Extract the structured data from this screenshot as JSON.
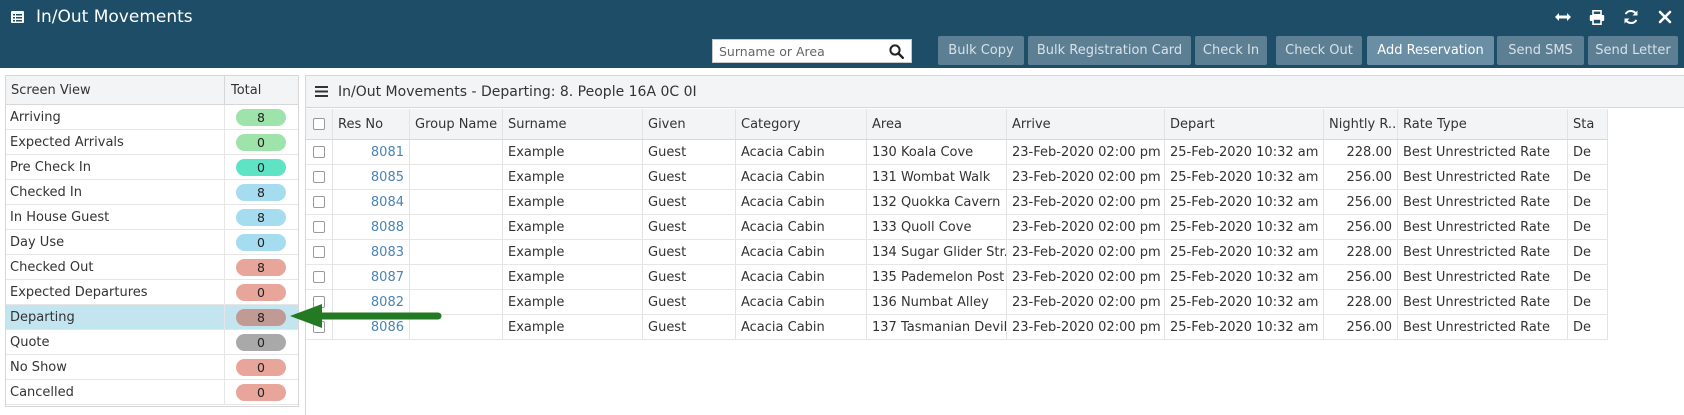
{
  "window": {
    "title": "In/Out Movements",
    "icons": [
      "resize-icon",
      "print-icon",
      "refresh-icon",
      "close-icon"
    ]
  },
  "toolbar": {
    "search_placeholder": "Surname or Area",
    "buttons": {
      "bulk_copy": "Bulk Copy",
      "bulk_registration_card": "Bulk Registration Card",
      "check_in": "Check In",
      "check_out": "Check Out",
      "add_reservation": "Add Reservation",
      "send_sms": "Send SMS",
      "send_letter": "Send Letter"
    }
  },
  "screen_view": {
    "header_view": "Screen View",
    "header_total": "Total",
    "selected": "Departing",
    "items": [
      {
        "label": "Arriving",
        "total": "8",
        "color": "#9ee3a9"
      },
      {
        "label": "Expected Arrivals",
        "total": "0",
        "color": "#9ee3a9"
      },
      {
        "label": "Pre Check In",
        "total": "0",
        "color": "#5ee3c4"
      },
      {
        "label": "Checked In",
        "total": "8",
        "color": "#a6dcef"
      },
      {
        "label": "In House Guest",
        "total": "8",
        "color": "#a6dcef"
      },
      {
        "label": "Day Use",
        "total": "0",
        "color": "#a6dcef"
      },
      {
        "label": "Checked Out",
        "total": "8",
        "color": "#e8a599"
      },
      {
        "label": "Expected Departures",
        "total": "0",
        "color": "#e8a599"
      },
      {
        "label": "Departing",
        "total": "8",
        "color": "#c09a93"
      },
      {
        "label": "Quote",
        "total": "0",
        "color": "#a9a9a9"
      },
      {
        "label": "No Show",
        "total": "0",
        "color": "#e8a599"
      },
      {
        "label": "Cancelled",
        "total": "0",
        "color": "#e8a599"
      }
    ]
  },
  "grid": {
    "title": "In/Out Movements - Departing: 8. People 16A 0C 0I",
    "columns": [
      "Res No",
      "Group Name",
      "Surname",
      "Given",
      "Category",
      "Area",
      "Arrive",
      "Depart",
      "Nightly R...",
      "Rate Type",
      "Sta"
    ],
    "rows": [
      {
        "res_no": "8081",
        "group": "",
        "surname": "Example",
        "given": "Guest",
        "category": "Acacia Cabin",
        "area": "130 Koala Cove",
        "arrive": "23-Feb-2020 02:00 pm",
        "depart": "25-Feb-2020 10:32 am",
        "rate": "228.00",
        "rate_type": "Best Unrestricted Rate",
        "status": "De"
      },
      {
        "res_no": "8085",
        "group": "",
        "surname": "Example",
        "given": "Guest",
        "category": "Acacia Cabin",
        "area": "131 Wombat Walk",
        "arrive": "23-Feb-2020 02:00 pm",
        "depart": "25-Feb-2020 10:32 am",
        "rate": "256.00",
        "rate_type": "Best Unrestricted Rate",
        "status": "De"
      },
      {
        "res_no": "8084",
        "group": "",
        "surname": "Example",
        "given": "Guest",
        "category": "Acacia Cabin",
        "area": "132 Quokka Cavern",
        "arrive": "23-Feb-2020 02:00 pm",
        "depart": "25-Feb-2020 10:32 am",
        "rate": "256.00",
        "rate_type": "Best Unrestricted Rate",
        "status": "De"
      },
      {
        "res_no": "8088",
        "group": "",
        "surname": "Example",
        "given": "Guest",
        "category": "Acacia Cabin",
        "area": "133 Quoll Cove",
        "arrive": "23-Feb-2020 02:00 pm",
        "depart": "25-Feb-2020 10:32 am",
        "rate": "256.00",
        "rate_type": "Best Unrestricted Rate",
        "status": "De"
      },
      {
        "res_no": "8083",
        "group": "",
        "surname": "Example",
        "given": "Guest",
        "category": "Acacia Cabin",
        "area": "134 Sugar Glider Str...",
        "arrive": "23-Feb-2020 02:00 pm",
        "depart": "25-Feb-2020 10:32 am",
        "rate": "228.00",
        "rate_type": "Best Unrestricted Rate",
        "status": "De"
      },
      {
        "res_no": "8087",
        "group": "",
        "surname": "Example",
        "given": "Guest",
        "category": "Acacia Cabin",
        "area": "135 Pademelon Post",
        "arrive": "23-Feb-2020 02:00 pm",
        "depart": "25-Feb-2020 10:32 am",
        "rate": "256.00",
        "rate_type": "Best Unrestricted Rate",
        "status": "De"
      },
      {
        "res_no": "8082",
        "group": "",
        "surname": "Example",
        "given": "Guest",
        "category": "Acacia Cabin",
        "area": "136 Numbat Alley",
        "arrive": "23-Feb-2020 02:00 pm",
        "depart": "25-Feb-2020 10:32 am",
        "rate": "228.00",
        "rate_type": "Best Unrestricted Rate",
        "status": "De"
      },
      {
        "res_no": "8086",
        "group": "",
        "surname": "Example",
        "given": "Guest",
        "category": "Acacia Cabin",
        "area": "137 Tasmanian Devil...",
        "arrive": "23-Feb-2020 02:00 pm",
        "depart": "25-Feb-2020 10:32 am",
        "rate": "256.00",
        "rate_type": "Best Unrestricted Rate",
        "status": "De"
      }
    ]
  },
  "colors": {
    "header_bg": "#1e4d67",
    "button_bg": "#5d7f93",
    "selected_row": "#c2e5f0",
    "link": "#4a84b5",
    "arrow": "#237a22"
  }
}
